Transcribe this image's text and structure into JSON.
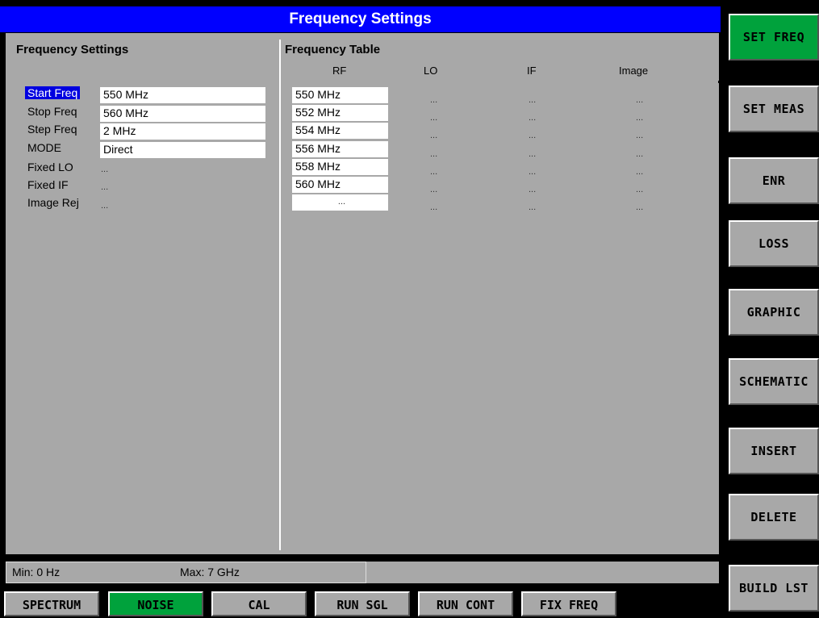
{
  "title": "Frequency Settings",
  "settings": {
    "heading": "Frequency Settings",
    "rows": [
      {
        "label": "Start Freq",
        "value": "550 MHz",
        "selected": true
      },
      {
        "label": "Stop Freq",
        "value": "560 MHz"
      },
      {
        "label": "Step Freq",
        "value": "2 MHz"
      },
      {
        "label": "MODE",
        "value": "Direct"
      },
      {
        "label": "Fixed LO",
        "value": "..."
      },
      {
        "label": "Fixed IF",
        "value": "..."
      },
      {
        "label": "Image Rej",
        "value": "..."
      }
    ]
  },
  "table": {
    "heading": "Frequency Table",
    "columns": [
      "RF",
      "LO",
      "IF",
      "Image"
    ],
    "rows": [
      [
        "550 MHz",
        "...",
        "...",
        "..."
      ],
      [
        "552 MHz",
        "...",
        "...",
        "..."
      ],
      [
        "554 MHz",
        "...",
        "...",
        "..."
      ],
      [
        "556 MHz",
        "...",
        "...",
        "..."
      ],
      [
        "558 MHz",
        "...",
        "...",
        "..."
      ],
      [
        "560 MHz",
        "...",
        "...",
        "..."
      ],
      [
        "...",
        "...",
        "...",
        "..."
      ]
    ]
  },
  "status": {
    "min": "Min: 0 Hz",
    "max": "Max: 7 GHz"
  },
  "hotkeys": [
    {
      "label": "SPECTRUM",
      "active": false
    },
    {
      "label": "NOISE",
      "active": true
    },
    {
      "label": "CAL",
      "active": false
    },
    {
      "label": "RUN SGL",
      "active": false
    },
    {
      "label": "RUN CONT",
      "active": false
    },
    {
      "label": "FIX FREQ",
      "active": false
    }
  ],
  "softkeys": [
    {
      "label": "SET FREQ",
      "active": true
    },
    {
      "label": "SET MEAS",
      "active": false
    },
    {
      "label": "ENR",
      "active": false
    },
    {
      "label": "LOSS",
      "active": false
    },
    {
      "label": "GRAPHIC",
      "active": false
    },
    {
      "label": "SCHEMATIC",
      "active": false
    },
    {
      "label": "INSERT",
      "active": false
    },
    {
      "label": "DELETE",
      "active": false
    },
    {
      "label": "BUILD LST",
      "active": false
    }
  ],
  "colors": {
    "title_bar": "#0000ff",
    "panel": "#a8a8a8",
    "active_key": "#00a23c",
    "selection": "#0000e0"
  }
}
